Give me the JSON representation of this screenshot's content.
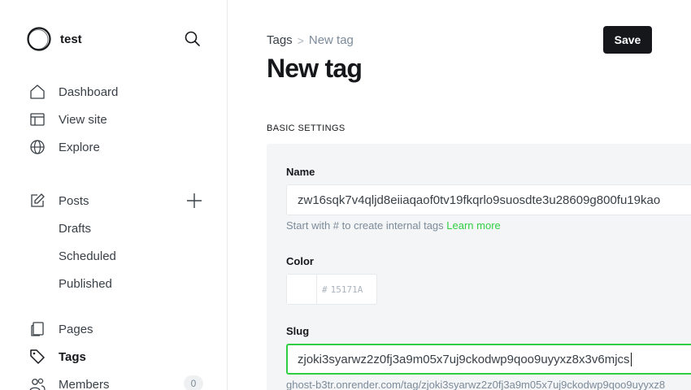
{
  "site": {
    "name": "test"
  },
  "icons": {
    "brand": "ghost-circle-logo",
    "search": "search-icon",
    "dashboard": "home-icon",
    "view_site": "layout-icon",
    "explore": "globe-icon",
    "posts": "pen-icon",
    "add_post": "plus-icon",
    "pages": "page-icon",
    "tags": "tag-icon",
    "members": "members-icon"
  },
  "sidebar": {
    "dashboard": "Dashboard",
    "view_site": "View site",
    "explore": "Explore",
    "posts": "Posts",
    "drafts": "Drafts",
    "scheduled": "Scheduled",
    "published": "Published",
    "pages": "Pages",
    "tags": "Tags",
    "members": "Members",
    "members_count": "0"
  },
  "header": {
    "breadcrumb_parent": "Tags",
    "breadcrumb_separator": ">",
    "breadcrumb_current": "New tag",
    "title": "New tag",
    "save_label": "Save"
  },
  "form": {
    "section_title": "BASIC SETTINGS",
    "name_label": "Name",
    "name_value": "zw16sqk7v4qljd8eiiaqaof0tv19fkqrlo9suosdte3u28609g800fu19kao",
    "name_hint": "Start with # to create internal tags",
    "learn_more": "Learn more",
    "color_label": "Color",
    "color_hash": "#",
    "color_value": "15171A",
    "slug_label": "Slug",
    "slug_value": "zjoki3syarwz2z0fj3a9m05x7uj9ckodwp9qoo9uyyxz8x3v6mjcs",
    "slug_url": "ghost-b3tr.onrender.com/tag/zjoki3syarwz2z0fj3a9m05x7uj9ckodwp9qoo9uyyxz8"
  },
  "colors": {
    "accent_green": "#30cf43",
    "primary_dark": "#15171a",
    "panel_bg": "#f4f5f6"
  }
}
